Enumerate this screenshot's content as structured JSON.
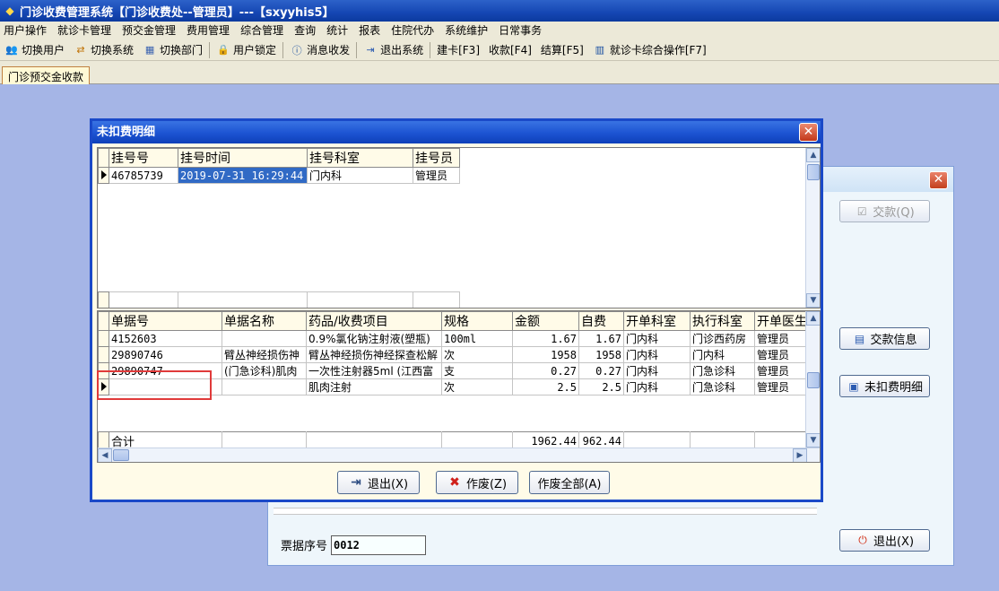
{
  "window": {
    "title": "门诊收费管理系统【门诊收费处--管理员】---【sxyyhis5】"
  },
  "menu": [
    "用户操作",
    "就诊卡管理",
    "预交金管理",
    "费用管理",
    "综合管理",
    "查询",
    "统计",
    "报表",
    "住院代办",
    "系统维护",
    "日常事务"
  ],
  "toolbar": {
    "switch_user": "切换用户",
    "switch_system": "切换系统",
    "switch_dept": "切换部门",
    "user_lock": "用户锁定",
    "message": "消息收发",
    "exit_system": "退出系统",
    "create_card": "建卡[F3]",
    "charge": "收款[F4]",
    "settle": "结算[F5]",
    "card_ops": "就诊卡综合操作[F7]"
  },
  "tab": {
    "label": "门诊预交金收款"
  },
  "bg_window": {
    "pay_button": "交款(Q)",
    "pay_info_button": "交款信息",
    "unpaid_detail_button": "未扣费明细",
    "exit_button": "退出(X)",
    "receipt_label": "票据序号",
    "receipt_value": "0012"
  },
  "dialog": {
    "title": "未扣费明细",
    "reg_grid": {
      "headers": [
        "挂号号",
        "挂号时间",
        "挂号科室",
        "挂号员"
      ],
      "rows": [
        [
          "46785739",
          "2019-07-31 16:29:44",
          "门内科",
          "管理员"
        ]
      ]
    },
    "detail_grid": {
      "headers": [
        "单据号",
        "单据名称",
        "药品/收费项目",
        "规格",
        "金额",
        "自费",
        "开单科室",
        "执行科室",
        "开单医生"
      ],
      "rows": [
        [
          "4152603",
          "",
          "0.9%氯化钠注射液(塑瓶)",
          "100ml",
          "1.67",
          "1.67",
          "门内科",
          "门诊西药房",
          "管理员"
        ],
        [
          "29890746",
          "臂丛神经损伤神",
          "臂丛神经损伤神经探查松解",
          "次",
          "1958",
          "1958",
          "门内科",
          "门内科",
          "管理员"
        ],
        [
          "29890747",
          "(门急诊科)肌肉",
          "一次性注射器5ml (江西富",
          "支",
          "0.27",
          "0.27",
          "门内科",
          "门急诊科",
          "管理员"
        ],
        [
          "",
          "",
          "肌肉注射",
          "次",
          "2.5",
          "2.5",
          "门内科",
          "门急诊科",
          "管理员"
        ]
      ],
      "total_label": "合计",
      "total_amount": "1962.44",
      "total_self": "962.44"
    },
    "exit_button": "退出(X)",
    "void_button": "作废(Z)",
    "void_all_button": "作废全部(A)"
  }
}
